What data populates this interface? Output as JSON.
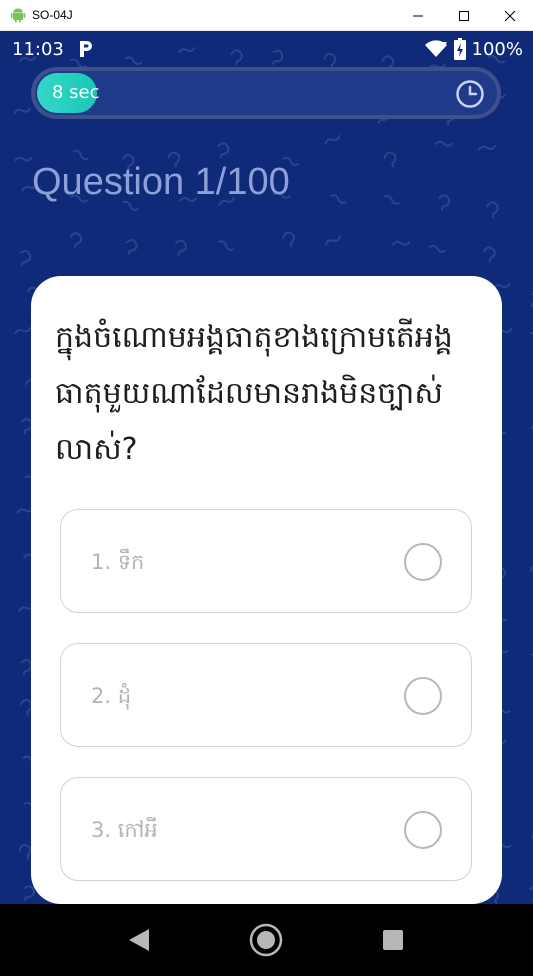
{
  "window": {
    "title": "SO-04J"
  },
  "statusbar": {
    "time": "11:03",
    "battery": "100%"
  },
  "timer": {
    "label": "8 sec",
    "progress": 0.13
  },
  "quiz": {
    "heading": "Question 1/100",
    "question": "ក្នុងចំណោមអង្គធាតុខាងក្រោមតើអង្គធាតុមួយណាដែលមានរាងមិនច្បាស់លាស់?",
    "options": [
      {
        "label": "1. ទឹក"
      },
      {
        "label": "2. ដុំ"
      },
      {
        "label": "3. កៅអី"
      }
    ]
  },
  "colors": {
    "background": "#0f2a78",
    "timer_fill": "#28cfc0",
    "card": "#ffffff"
  },
  "icons": [
    "android-icon",
    "minimize-icon",
    "maximize-icon",
    "close-icon",
    "parking-icon",
    "wifi-icon",
    "battery-icon",
    "clock-icon",
    "back-icon",
    "home-icon",
    "recents-icon"
  ]
}
